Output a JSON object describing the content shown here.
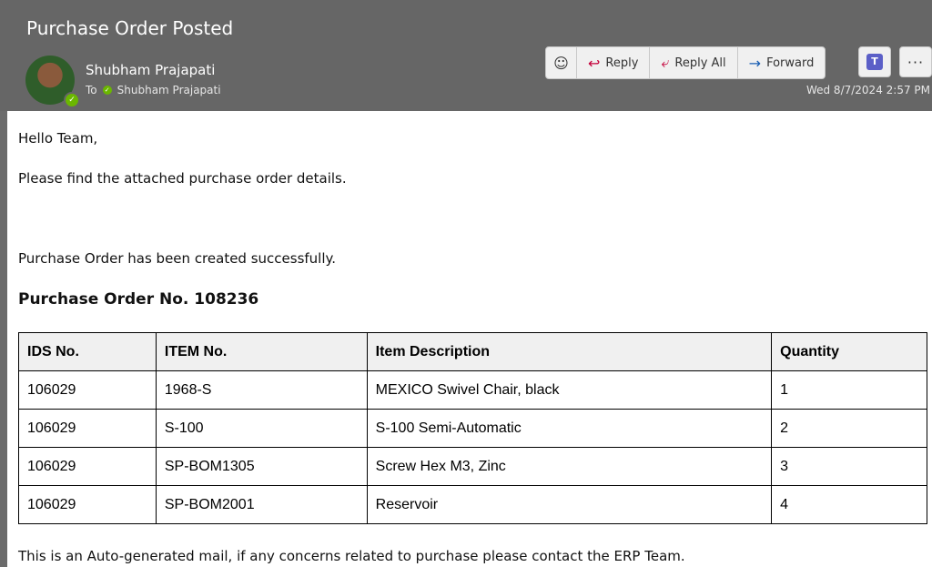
{
  "email": {
    "subject": "Purchase Order Posted",
    "sender": "Shubham Prajapati",
    "to_label": "To",
    "recipient": "Shubham Prajapati",
    "datetime": "Wed 8/7/2024 2:57 PM"
  },
  "actions": {
    "emoji_icon": "☺",
    "reply_icon": "↩",
    "reply": "Reply",
    "reply_all_icon": "⤶",
    "reply_all": "Reply All",
    "forward_icon": "→",
    "forward": "Forward",
    "teams_label": "T",
    "more": "···"
  },
  "body": {
    "greeting": "Hello Team,",
    "line1": "Please find the attached purchase order details.",
    "line2": "Purchase Order has been created successfully.",
    "po_title": "Purchase Order No. 108236",
    "footer": "This is an Auto-generated mail, if any concerns related to purchase please contact the ERP Team."
  },
  "table": {
    "headers": [
      "IDS No.",
      "ITEM No.",
      "Item Description",
      "Quantity"
    ],
    "rows": [
      [
        "106029",
        "1968-S",
        "MEXICO Swivel Chair, black",
        "1"
      ],
      [
        "106029",
        "S-100",
        "S-100 Semi-Automatic",
        "2"
      ],
      [
        "106029",
        "SP-BOM1305",
        "Screw Hex M3, Zinc",
        "3"
      ],
      [
        "106029",
        "SP-BOM2001",
        "Reservoir",
        "4"
      ]
    ]
  }
}
